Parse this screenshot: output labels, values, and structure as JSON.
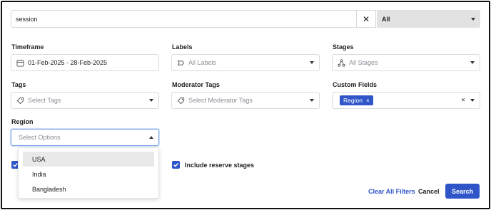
{
  "search": {
    "value": "session",
    "clear_icon": "close-icon"
  },
  "scope": {
    "selected": "All"
  },
  "timeframe": {
    "label": "Timeframe",
    "value": "01-Feb-2025 - 28-Feb-2025",
    "icon": "calendar-icon"
  },
  "labels": {
    "label": "Labels",
    "placeholder": "All Labels",
    "icon": "label-icon"
  },
  "stages": {
    "label": "Stages",
    "placeholder": "All Stages",
    "icon": "stages-icon"
  },
  "tags": {
    "label": "Tags",
    "placeholder": "Select Tags",
    "icon": "tag-icon"
  },
  "moderator_tags": {
    "label": "Moderator Tags",
    "placeholder": "Select Moderator Tags",
    "icon": "tag-icon"
  },
  "custom_fields": {
    "label": "Custom Fields",
    "chip": "Region",
    "chip_remove": "×",
    "clear": "×"
  },
  "region": {
    "label": "Region",
    "placeholder": "Select Options",
    "options": [
      "USA",
      "India",
      "Bangladesh"
    ],
    "highlighted_index": 0
  },
  "checkboxes": {
    "include_reserve": "Include reserve stages"
  },
  "footer": {
    "clear_all": "Clear All Filters",
    "cancel": "Cancel",
    "search": "Search"
  },
  "colors": {
    "accent": "#2f55c8",
    "border": "#d9dce0",
    "focus": "#7aa3e8",
    "scope_bg": "#e2e2e2"
  }
}
